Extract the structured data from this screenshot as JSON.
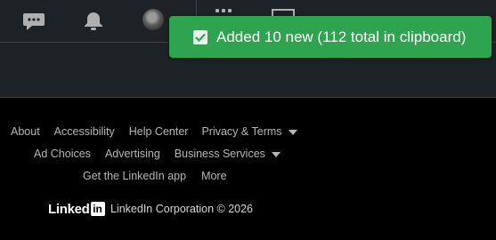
{
  "header": {
    "icons": [
      "messaging-icon",
      "notifications-icon",
      "profile-avatar",
      "apps-grid-icon",
      "advertise-icon"
    ]
  },
  "toast": {
    "message": "Added 10 new (112 total in clipboard)",
    "color": "#2ea44f"
  },
  "footer": {
    "row1": {
      "about": "About",
      "accessibility": "Accessibility",
      "help_center": "Help Center",
      "privacy_terms": "Privacy & Terms"
    },
    "row2": {
      "ad_choices": "Ad Choices",
      "advertising": "Advertising",
      "business_services": "Business Services"
    },
    "row3": {
      "get_app": "Get the LinkedIn app",
      "more": "More"
    },
    "brand": {
      "word": "Linked",
      "box": "in",
      "copyright": "LinkedIn Corporation © 2026"
    }
  }
}
